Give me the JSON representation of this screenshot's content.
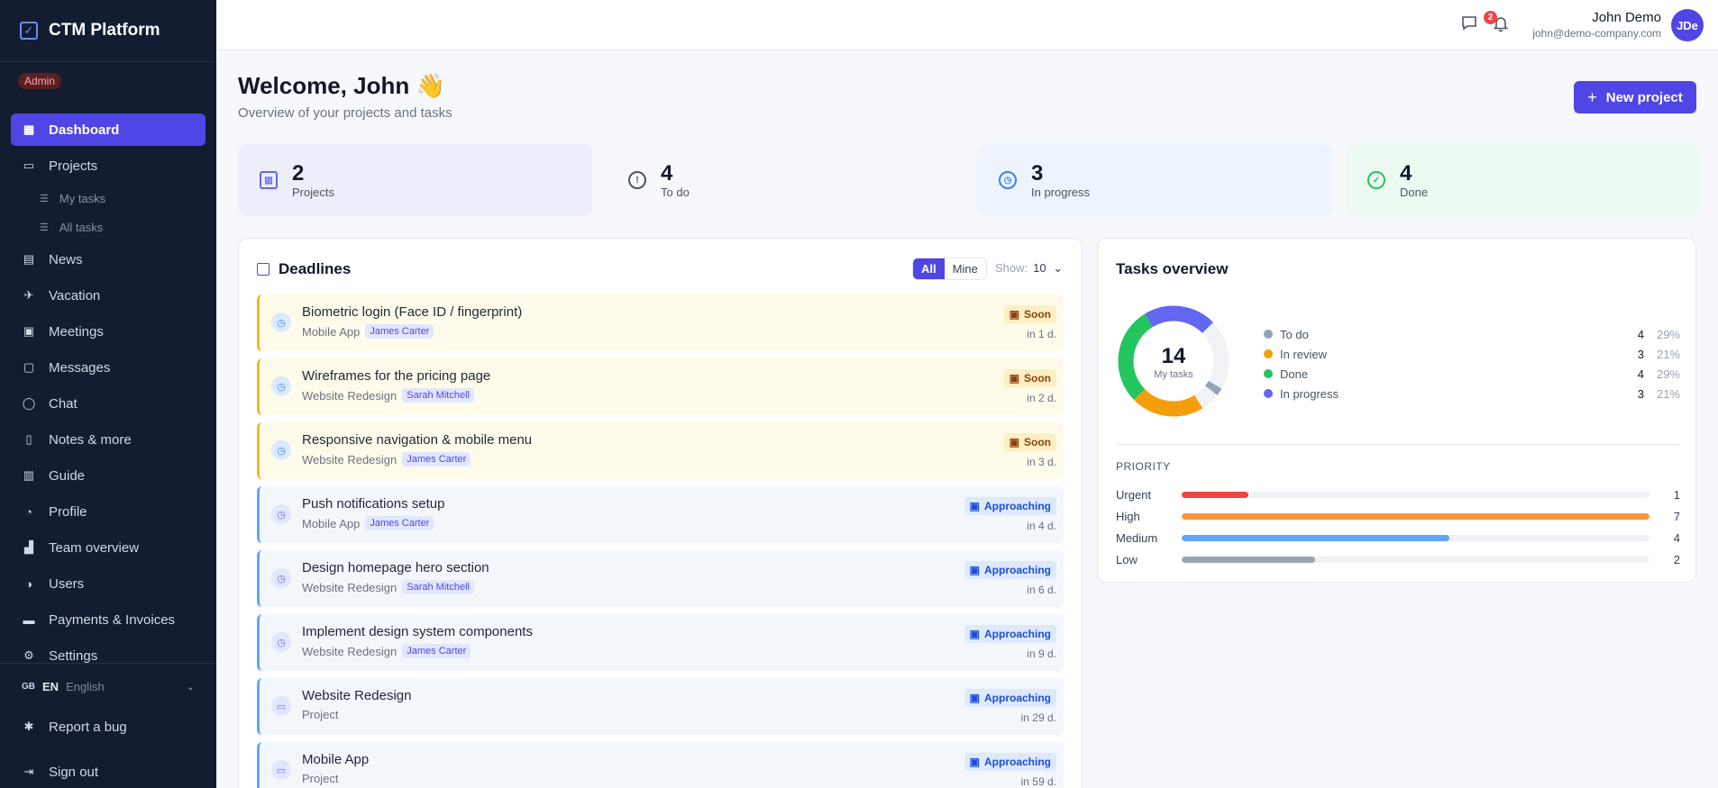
{
  "app": {
    "title": "CTM Platform",
    "role": "Admin"
  },
  "sidebar": {
    "items": [
      {
        "label": "Dashboard",
        "icon": "grid-icon",
        "active": true
      },
      {
        "label": "Projects",
        "icon": "folder-icon"
      },
      {
        "label": "My tasks",
        "icon": "list-icon",
        "sub": true
      },
      {
        "label": "All tasks",
        "icon": "list-icon",
        "sub": true
      },
      {
        "label": "News",
        "icon": "newspaper-icon"
      },
      {
        "label": "Vacation",
        "icon": "plane-icon"
      },
      {
        "label": "Meetings",
        "icon": "calendar-icon"
      },
      {
        "label": "Messages",
        "icon": "message-icon"
      },
      {
        "label": "Chat",
        "icon": "chat-icon"
      },
      {
        "label": "Notes & more",
        "icon": "note-icon"
      },
      {
        "label": "Guide",
        "icon": "book-icon"
      },
      {
        "label": "Profile",
        "icon": "user-icon"
      },
      {
        "label": "Team overview",
        "icon": "chart-icon"
      },
      {
        "label": "Users",
        "icon": "users-icon"
      },
      {
        "label": "Payments & Invoices",
        "icon": "card-icon"
      },
      {
        "label": "Settings",
        "icon": "gear-icon"
      }
    ],
    "language": {
      "flag": "GB",
      "code": "EN",
      "name": "English"
    },
    "bottom": [
      {
        "label": "Report a bug",
        "icon": "bug-icon"
      },
      {
        "label": "Sign out",
        "icon": "logout-icon"
      }
    ]
  },
  "topbar": {
    "message_count": "2",
    "user_name": "John Demo",
    "user_email": "john@demo-company.com",
    "avatar_initials": "JDe"
  },
  "header": {
    "title": "Welcome, John 👋",
    "subtitle": "Overview of your projects and tasks",
    "new_project_label": "New project"
  },
  "stats": [
    {
      "value": "2",
      "label": "Projects",
      "color": "#6366f1",
      "bg": "#eceffa"
    },
    {
      "value": "4",
      "label": "To do",
      "color": "#4b5563",
      "bg": "#f6f8fb"
    },
    {
      "value": "3",
      "label": "In progress",
      "color": "#3b82f6",
      "bg": "#edf4fe"
    },
    {
      "value": "4",
      "label": "Done",
      "color": "#22c55e",
      "bg": "#edfaf2"
    }
  ],
  "deadlines": {
    "title": "Deadlines",
    "filter_all": "All",
    "filter_mine": "Mine",
    "show_label": "Show:",
    "show_value": "10",
    "items": [
      {
        "title": "Biometric login (Face ID / fingerprint)",
        "project": "Mobile App",
        "assignee": "James Carter",
        "status": "Soon",
        "due": "in 1 d.",
        "kind": "soon"
      },
      {
        "title": "Wireframes for the pricing page",
        "project": "Website Redesign",
        "assignee": "Sarah Mitchell",
        "status": "Soon",
        "due": "in 2 d.",
        "kind": "soon"
      },
      {
        "title": "Responsive navigation & mobile menu",
        "project": "Website Redesign",
        "assignee": "James Carter",
        "status": "Soon",
        "due": "in 3 d.",
        "kind": "soon"
      },
      {
        "title": "Push notifications setup",
        "project": "Mobile App",
        "assignee": "James Carter",
        "status": "Approaching",
        "due": "in 4 d.",
        "kind": "appr"
      },
      {
        "title": "Design homepage hero section",
        "project": "Website Redesign",
        "assignee": "Sarah Mitchell",
        "status": "Approaching",
        "due": "in 6 d.",
        "kind": "appr"
      },
      {
        "title": "Implement design system components",
        "project": "Website Redesign",
        "assignee": "James Carter",
        "status": "Approaching",
        "due": "in 9 d.",
        "kind": "appr"
      },
      {
        "title": "Website Redesign",
        "project": "Project",
        "assignee": "",
        "status": "Approaching",
        "due": "in 29 d.",
        "kind": "appr"
      },
      {
        "title": "Mobile App",
        "project": "Project",
        "assignee": "",
        "status": "Approaching",
        "due": "in 59 d.",
        "kind": "appr"
      }
    ]
  },
  "overview": {
    "title": "Tasks overview",
    "total": "14",
    "total_label": "My tasks",
    "statuses": [
      {
        "name": "To do",
        "count": 4,
        "pct": "29%",
        "color": "#94a3b8"
      },
      {
        "name": "In review",
        "count": 3,
        "pct": "21%",
        "color": "#f59e0b"
      },
      {
        "name": "Done",
        "count": 4,
        "pct": "29%",
        "color": "#22c55e"
      },
      {
        "name": "In progress",
        "count": 3,
        "pct": "21%",
        "color": "#6366f1"
      }
    ],
    "priority_label": "PRIORITY",
    "priorities": [
      {
        "name": "Urgent",
        "count": 1,
        "color": "#ef4444"
      },
      {
        "name": "High",
        "count": 7,
        "color": "#fb923c"
      },
      {
        "name": "Medium",
        "count": 4,
        "color": "#60a5fa"
      },
      {
        "name": "Low",
        "count": 2,
        "color": "#9ca3af"
      }
    ]
  }
}
